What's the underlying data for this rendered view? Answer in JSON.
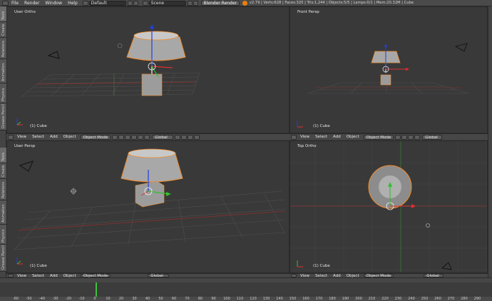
{
  "menubar": {
    "menus": [
      "File",
      "Render",
      "Window",
      "Help"
    ],
    "layout": "Default",
    "scene": "Scene",
    "engine": "Blender Render",
    "stats": "v2.79 | Verts:628 | Faces:320 | Tris:1,244 | Objects:5/5 | Lamps:0/1 | Mem:20.32M | Cube"
  },
  "left_tabs": [
    "Tools",
    "Create",
    "Relations",
    "Animation",
    "Physics",
    "Grease Pencil"
  ],
  "viewports": [
    {
      "label": "User Ortho",
      "object": "(1) Cube"
    },
    {
      "label": "Front Persp",
      "object": "(1) Cube"
    },
    {
      "label": "User Persp",
      "object": "(1) Cube"
    },
    {
      "label": "Top Ortho",
      "object": "(1) Cube"
    }
  ],
  "viewport_header": {
    "view": "View",
    "select": "Select",
    "add": "Add",
    "object": "Object",
    "mode": "Object Mode",
    "orientation": "Global"
  },
  "timeline": {
    "ticks": [
      "-60",
      "-50",
      "-40",
      "-30",
      "-20",
      "-10",
      "0",
      "10",
      "20",
      "30",
      "40",
      "50",
      "60",
      "70",
      "80",
      "90",
      "100",
      "110",
      "120",
      "130",
      "140",
      "150",
      "160",
      "170",
      "180",
      "190",
      "200",
      "210",
      "220",
      "230",
      "240",
      "250",
      "260",
      "270",
      "280",
      "290"
    ],
    "current_frame": 1
  },
  "colors": {
    "x_axis": "#e03030",
    "y_axis": "#30c030",
    "z_axis": "#2040e0",
    "selection": "#f08a2a",
    "grid": "#555555",
    "current_frame": "#3fbf3f"
  }
}
